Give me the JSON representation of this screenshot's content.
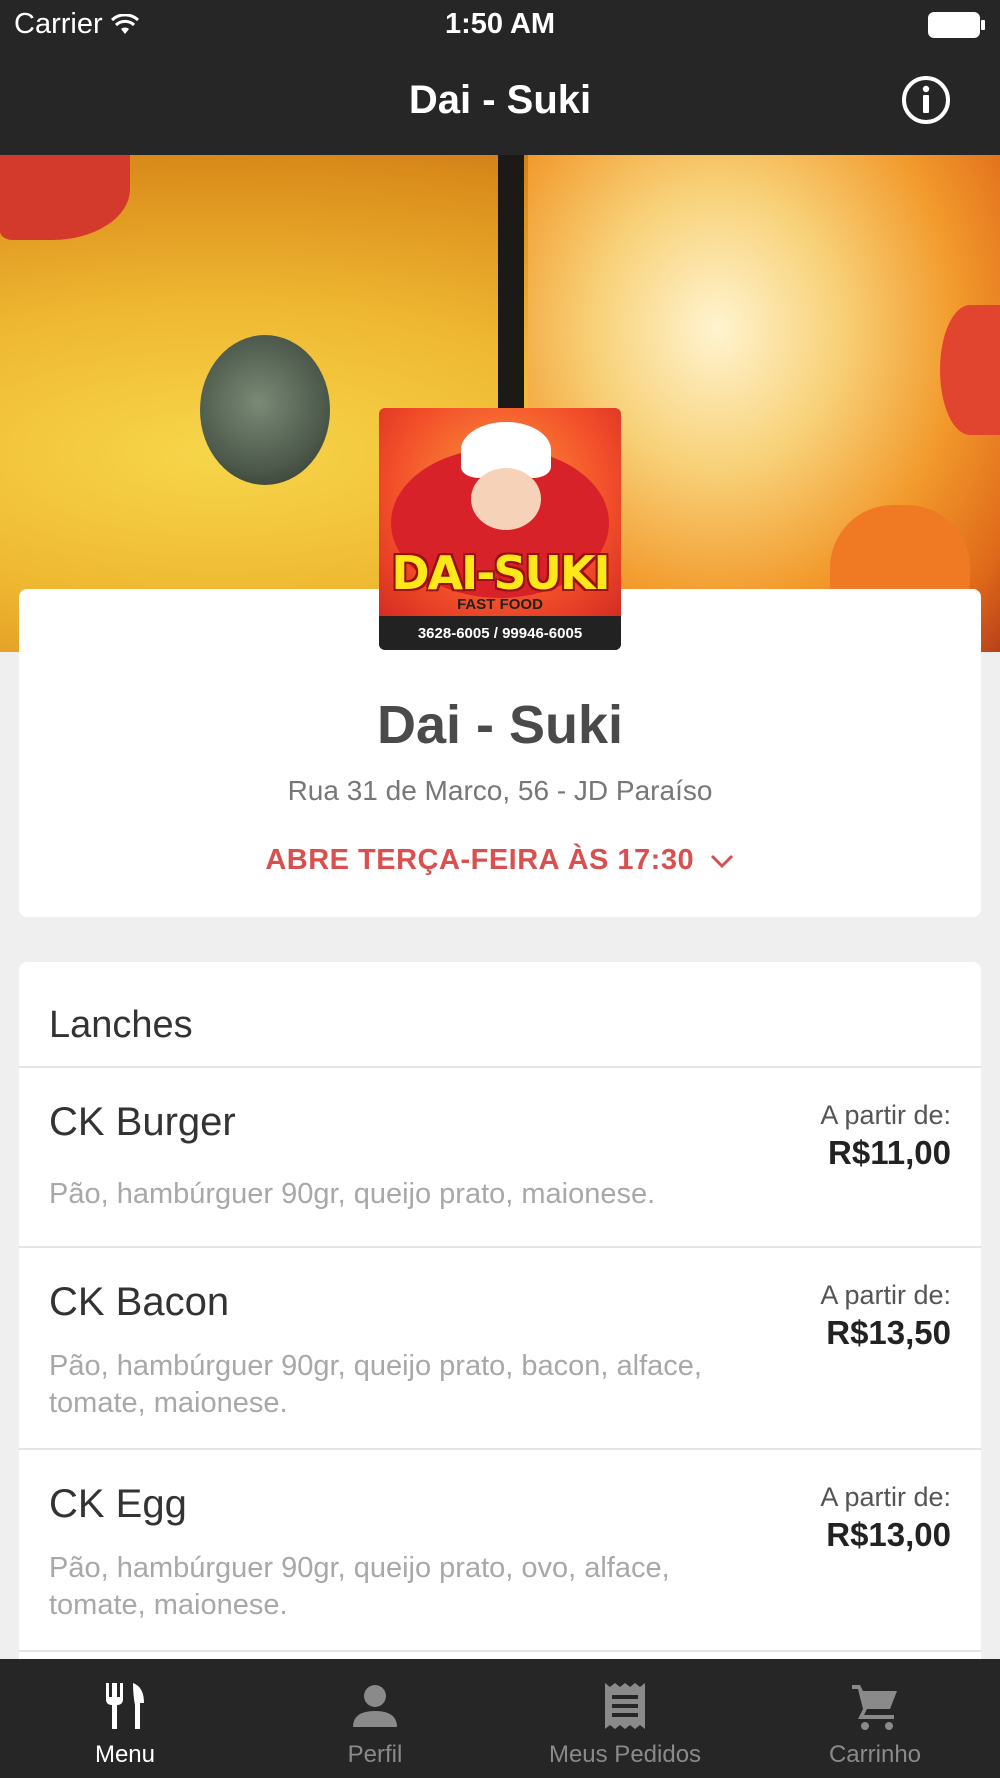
{
  "status_bar": {
    "carrier": "Carrier",
    "time": "1:50 AM"
  },
  "nav": {
    "title": "Dai - Suki"
  },
  "logo": {
    "brand": "DAI-SUKI",
    "subtitle": "FAST FOOD",
    "phone": "3628-6005 / 99946-6005"
  },
  "restaurant": {
    "name": "Dai - Suki",
    "address": "Rua 31 de Marco, 56 - JD Paraíso",
    "hours": "ABRE TERÇA-FEIRA ÀS 17:30"
  },
  "menu": {
    "section_title": "Lanches",
    "items": [
      {
        "name": "CK Burger",
        "description": "Pão, hambúrguer 90gr, queijo prato, maionese.",
        "price_prefix": "A partir de:",
        "price": "R$11,00"
      },
      {
        "name": "CK Bacon",
        "description": "Pão, hambúrguer 90gr, queijo prato, bacon, alface, tomate, maionese.",
        "price_prefix": "A partir de:",
        "price": "R$13,50"
      },
      {
        "name": "CK Egg",
        "description": "Pão, hambúrguer 90gr, queijo prato, ovo, alface, tomate, maionese.",
        "price_prefix": "A partir de:",
        "price": "R$13,00"
      }
    ]
  },
  "tabs": [
    {
      "label": "Menu",
      "icon": "fork-knife-icon",
      "active": true
    },
    {
      "label": "Perfil",
      "icon": "person-icon",
      "active": false
    },
    {
      "label": "Meus Pedidos",
      "icon": "receipt-icon",
      "active": false
    },
    {
      "label": "Carrinho",
      "icon": "cart-icon",
      "active": false
    }
  ],
  "colors": {
    "bar_bg": "#262626",
    "accent_red": "#d8504f",
    "page_bg": "#efefef"
  }
}
